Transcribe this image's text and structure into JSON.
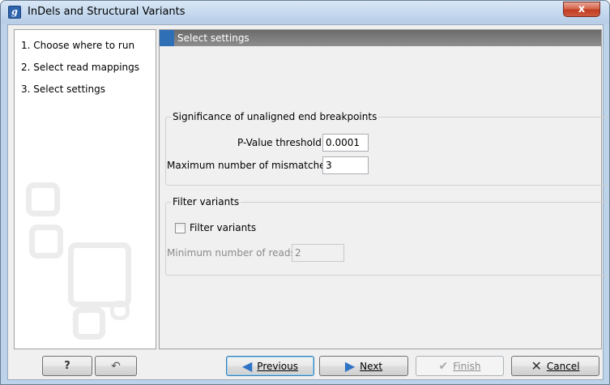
{
  "window": {
    "title": "InDels and Structural Variants",
    "app_icon_letter": "g",
    "close_symbol": "x"
  },
  "steps": [
    "1.  Choose where to run",
    "2.  Select read mappings",
    "3.  Select settings"
  ],
  "section": {
    "title": "Select settings"
  },
  "breakpoints_group": {
    "legend": "Significance of unaligned end breakpoints",
    "pvalue_label": "P-Value threshold",
    "pvalue_value": "0.0001",
    "mismatches_label": "Maximum number of mismatches",
    "mismatches_value": "3"
  },
  "filter_group": {
    "legend": "Filter variants",
    "checkbox_label": "Filter variants",
    "checkbox_checked": false,
    "min_reads_label": "Minimum number of reads",
    "min_reads_value": "2"
  },
  "buttons": {
    "help": "?",
    "previous": "Previous",
    "next": "Next",
    "finish": "Finish",
    "cancel": "Cancel"
  },
  "colors": {
    "accent": "#2f6fb6",
    "header_bar": "#7c7c7c",
    "close_button": "#c23d22"
  }
}
